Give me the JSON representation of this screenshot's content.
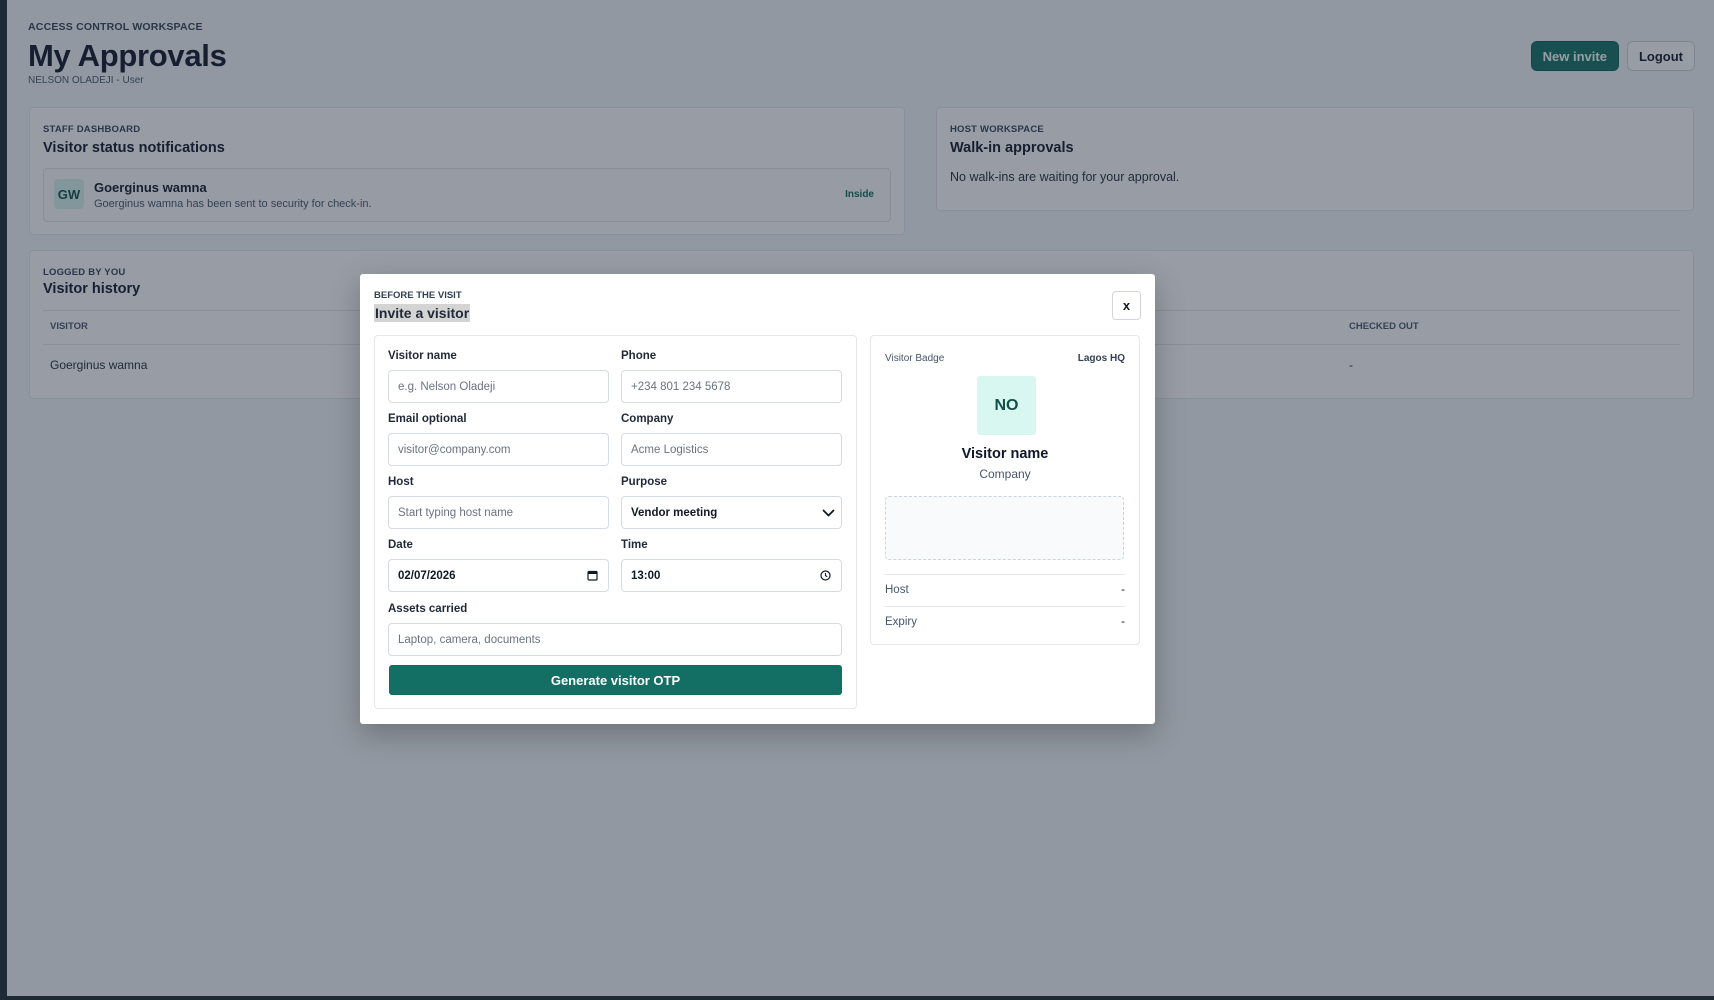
{
  "header": {
    "eyebrow": "ACCESS CONTROL WORKSPACE",
    "title": "My Approvals",
    "user_line": "NELSON OLADEJI - User",
    "new_invite_label": "New invite",
    "logout_label": "Logout"
  },
  "notifications_card": {
    "eyebrow": "STAFF DASHBOARD",
    "title": "Visitor status notifications",
    "items": [
      {
        "initials": "GW",
        "name": "Goerginus wamna",
        "message": "Goerginus wamna has been sent to security for check-in.",
        "status": "Inside"
      }
    ]
  },
  "walkin_card": {
    "eyebrow": "HOST WORKSPACE",
    "title": "Walk-in approvals",
    "empty_text": "No walk-ins are waiting for your approval."
  },
  "history_card": {
    "eyebrow": "LOGGED BY YOU",
    "title": "Visitor history",
    "columns": [
      "VISITOR",
      "CHECKED OUT"
    ],
    "rows": [
      {
        "visitor": "Goerginus wamna",
        "checked_out": "-"
      }
    ]
  },
  "modal": {
    "eyebrow": "BEFORE THE VISIT",
    "title": "Invite a visitor",
    "close_label": "x",
    "form": {
      "visitor_name": {
        "label": "Visitor name",
        "placeholder": "e.g. Nelson Oladeji"
      },
      "phone": {
        "label": "Phone",
        "placeholder": "+234 801 234 5678"
      },
      "email": {
        "label": "Email optional",
        "placeholder": "visitor@company.com"
      },
      "company": {
        "label": "Company",
        "placeholder": "Acme Logistics"
      },
      "host": {
        "label": "Host",
        "placeholder": "Start typing host name"
      },
      "purpose": {
        "label": "Purpose",
        "value": "Vendor meeting"
      },
      "date": {
        "label": "Date",
        "value": "02/07/2026"
      },
      "time": {
        "label": "Time",
        "value": "13:00"
      },
      "assets": {
        "label": "Assets carried",
        "placeholder": "Laptop, camera, documents"
      },
      "submit_label": "Generate visitor OTP"
    },
    "badge": {
      "label": "Visitor Badge",
      "site": "Lagos HQ",
      "initials": "NO",
      "name": "Visitor name",
      "company": "Company",
      "host_label": "Host",
      "host_value": "-",
      "expiry_label": "Expiry",
      "expiry_value": "-"
    }
  },
  "colors": {
    "accent": "#136f63",
    "avatar_bg": "#d9f7f1",
    "status_inside": "#0b6b57"
  },
  "icons": [
    "close-icon",
    "chevron-down-icon",
    "calendar-icon",
    "clock-icon"
  ]
}
